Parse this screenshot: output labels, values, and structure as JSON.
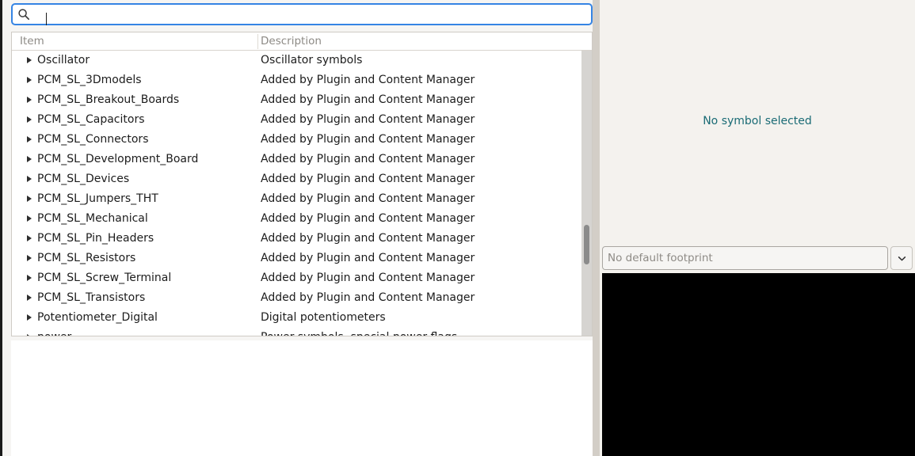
{
  "search": {
    "value": "",
    "placeholder": "",
    "icon": "search-icon"
  },
  "tree": {
    "columns": [
      {
        "key": "item",
        "label": "Item"
      },
      {
        "key": "description",
        "label": "Description"
      }
    ],
    "rows": [
      {
        "item": "Oscillator",
        "description": "Oscillator symbols"
      },
      {
        "item": "PCM_SL_3Dmodels",
        "description": "Added by Plugin and Content Manager"
      },
      {
        "item": "PCM_SL_Breakout_Boards",
        "description": "Added by Plugin and Content Manager"
      },
      {
        "item": "PCM_SL_Capacitors",
        "description": "Added by Plugin and Content Manager"
      },
      {
        "item": "PCM_SL_Connectors",
        "description": "Added by Plugin and Content Manager"
      },
      {
        "item": "PCM_SL_Development_Board",
        "description": "Added by Plugin and Content Manager"
      },
      {
        "item": "PCM_SL_Devices",
        "description": "Added by Plugin and Content Manager"
      },
      {
        "item": "PCM_SL_Jumpers_THT",
        "description": "Added by Plugin and Content Manager"
      },
      {
        "item": "PCM_SL_Mechanical",
        "description": "Added by Plugin and Content Manager"
      },
      {
        "item": "PCM_SL_Pin_Headers",
        "description": "Added by Plugin and Content Manager"
      },
      {
        "item": "PCM_SL_Resistors",
        "description": "Added by Plugin and Content Manager"
      },
      {
        "item": "PCM_SL_Screw_Terminal",
        "description": "Added by Plugin and Content Manager"
      },
      {
        "item": "PCM_SL_Transistors",
        "description": "Added by Plugin and Content Manager"
      },
      {
        "item": "Potentiometer_Digital",
        "description": "Digital potentiometers"
      },
      {
        "item": "power",
        "description": "Power symbols, special power flags"
      }
    ]
  },
  "preview": {
    "empty_message": "No symbol selected",
    "empty_message_color": "#1a6b75"
  },
  "footprint": {
    "value": "",
    "placeholder": "No default footprint",
    "dropdown_icon": "chevron-down-icon"
  },
  "colors": {
    "focus_border": "#3584e4",
    "panel_bg": "#f4f2ee",
    "list_bg": "#ffffff",
    "canvas_bg": "#000000",
    "header_text": "#8d8a85"
  }
}
